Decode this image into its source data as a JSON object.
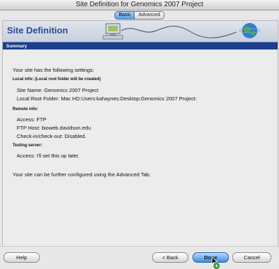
{
  "window": {
    "title": "Site Definition for Genomics 2007 Project"
  },
  "tabs": [
    {
      "label": "Basic",
      "selected": true
    },
    {
      "label": "Advanced",
      "selected": false
    }
  ],
  "banner": {
    "title": "Site Definition",
    "summary_label": "Summary"
  },
  "content": {
    "intro": "Your site has the following settings:",
    "local_heading": "Local info: (Local root folder will be created)",
    "site_name": "Site Name: Genomics 2007 Project",
    "local_root": "Local Root Folder: Mac HD:Users:kahaynes:Desktop:Genomics 2007 Project:",
    "remote_heading": "Remote info:",
    "access": "Access: FTP",
    "ftp_host": "FTP Host: bioweb.davidson.edu",
    "checkin": "Check-in/check-out: Disabled.",
    "testing_heading": "Testing server:",
    "testing_access": "Access: I'll set this up later.",
    "footer": "Your site can be further configured using the Advanced Tab."
  },
  "buttons": {
    "help": "Help",
    "back": "< Back",
    "done": "Done",
    "cancel": "Cancel"
  },
  "colors": {
    "header_blue": "#1c3f8c",
    "title_blue": "#2b4a9a",
    "done_blue": "#3f8be0"
  }
}
